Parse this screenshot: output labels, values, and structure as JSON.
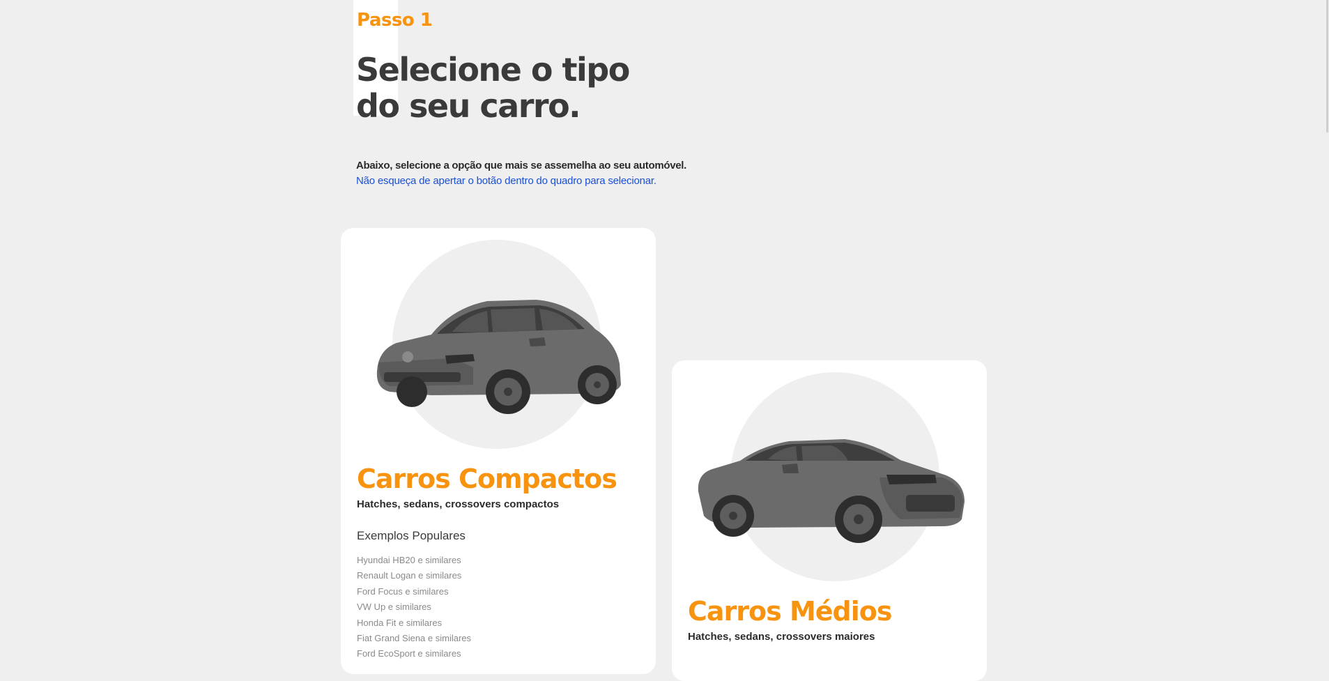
{
  "header": {
    "step": "Passo 1",
    "title": "Selecione o tipo do seu carro.",
    "intro_line1": "Abaixo, selecione a opção que mais se assemelha ao seu automóvel.",
    "intro_line2": "Não esqueça de apertar o botão dentro do quadro para selecionar."
  },
  "cards": [
    {
      "title": "Carros Compactos",
      "subtitle": "Hatches, sedans, crossovers compactos",
      "examples_heading": "Exemplos Populares",
      "examples": [
        "Hyundai HB20 e similares",
        "Renault Logan e similares",
        "Ford Focus e similares",
        "VW Up e similares",
        "Honda Fit e similares",
        "Fiat Grand Siena e similares",
        "Ford EcoSport e similares"
      ],
      "image": "compact-hatchback-car"
    },
    {
      "title": "Carros Médios",
      "subtitle": "Hatches, sedans, crossovers maiores",
      "image": "medium-sedan-car"
    }
  ],
  "colors": {
    "accent": "#f7930f",
    "link": "#1a4fd6",
    "background": "#efefef",
    "card": "#ffffff",
    "text": "#2b2b2b"
  }
}
